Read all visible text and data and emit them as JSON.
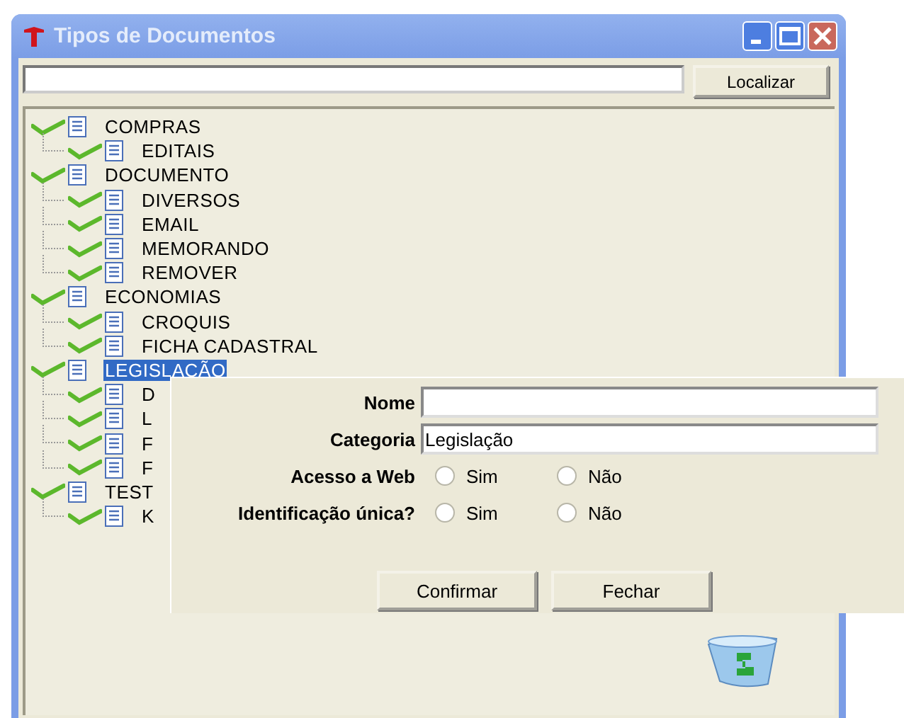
{
  "window": {
    "title": "Tipos de Documentos"
  },
  "search": {
    "button": {
      "label": "Localizar"
    }
  },
  "tree": [
    {
      "label": "COMPRAS",
      "selected": false,
      "children": [
        {
          "label": "EDITAIS",
          "selected": false
        }
      ]
    },
    {
      "label": "DOCUMENTO",
      "selected": false,
      "children": [
        {
          "label": "DIVERSOS",
          "selected": false
        },
        {
          "label": "EMAIL",
          "selected": false
        },
        {
          "label": "MEMORANDO",
          "selected": false
        },
        {
          "label": "REMOVER",
          "selected": false
        }
      ]
    },
    {
      "label": "ECONOMIAS",
      "selected": false,
      "children": [
        {
          "label": "CROQUIS",
          "selected": false
        },
        {
          "label": "FICHA CADASTRAL",
          "selected": false
        }
      ]
    },
    {
      "label": "LEGISLAÇÃO",
      "selected": true,
      "children": [
        {
          "label": "D",
          "selected": false
        },
        {
          "label": "L",
          "selected": false
        },
        {
          "label": "F",
          "selected": false
        },
        {
          "label": "F",
          "selected": false
        }
      ]
    },
    {
      "label": "TEST",
      "selected": false,
      "children": [
        {
          "label": "K",
          "selected": false
        }
      ]
    }
  ],
  "dialog": {
    "fields": [
      {
        "label": "Nome"
      },
      {
        "label": "Categoria",
        "value": "Legislação"
      }
    ],
    "radio_groups": [
      {
        "label": "Acesso a Web",
        "options": [
          {
            "label": "Sim",
            "selected": false
          },
          {
            "label": "Não",
            "selected": false
          }
        ]
      },
      {
        "label": "Identificação única?",
        "options": [
          {
            "label": "Sim",
            "selected": false
          },
          {
            "label": "Não",
            "selected": false
          }
        ]
      }
    ],
    "buttons": [
      {
        "label": "Confirmar"
      },
      {
        "label": "Fechar"
      }
    ]
  }
}
